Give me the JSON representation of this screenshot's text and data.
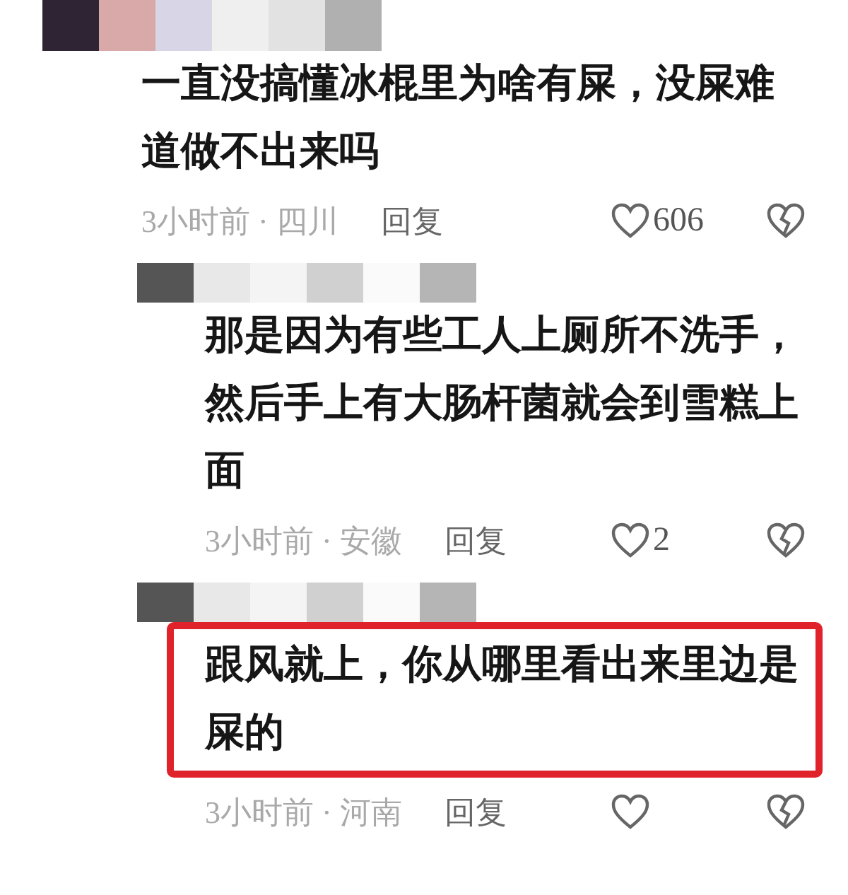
{
  "comments": [
    {
      "kind": "comment",
      "text": "一直没搞懂冰棍里为啥有屎，没屎难道做不出来吗",
      "meta": "3小时前 · 四川",
      "reply_label": "回复",
      "likes": "606",
      "highlighted": false
    },
    {
      "kind": "reply",
      "text": "那是因为有些工人上厕所不洗手，然后手上有大肠杆菌就会到雪糕上面",
      "meta": "3小时前 · 安徽",
      "reply_label": "回复",
      "likes": "2",
      "highlighted": false
    },
    {
      "kind": "reply",
      "text": "跟风就上，你从哪里看出来里边是屎的",
      "meta": "3小时前 · 河南",
      "reply_label": "回复",
      "highlighted": true
    }
  ]
}
